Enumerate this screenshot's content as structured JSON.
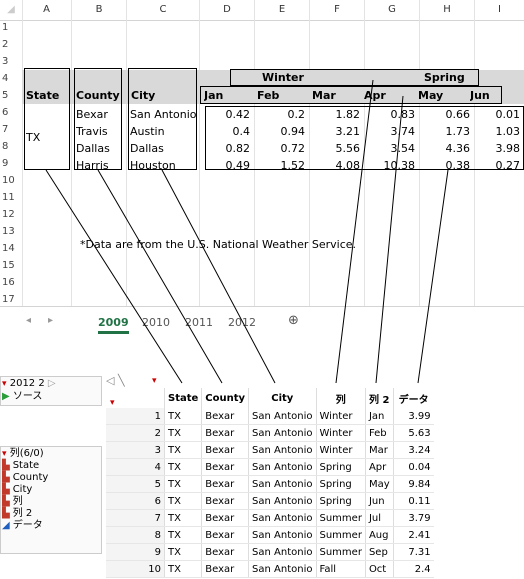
{
  "spreadsheet": {
    "columns": [
      "A",
      "B",
      "C",
      "D",
      "E",
      "F",
      "G",
      "H",
      "I"
    ],
    "rows": [
      "1",
      "2",
      "3",
      "4",
      "5",
      "6",
      "7",
      "8",
      "9",
      "10",
      "11",
      "12",
      "13",
      "14",
      "15",
      "16",
      "17"
    ],
    "header_row4": {
      "winter": "Winter",
      "spring": "Spring"
    },
    "header_row5": {
      "state": "State",
      "county": "County",
      "city": "City",
      "months": [
        "Jan",
        "Feb",
        "Mar",
        "Apr",
        "May",
        "Jun"
      ]
    },
    "state_value": "TX",
    "data_rows": [
      {
        "county": "Bexar",
        "city": "San Antonio",
        "values": [
          "0.42",
          "0.2",
          "1.82",
          "0.83",
          "0.66",
          "0.01"
        ]
      },
      {
        "county": "Travis",
        "city": "Austin",
        "values": [
          "0.4",
          "0.94",
          "3.21",
          "3.74",
          "1.73",
          "1.03"
        ]
      },
      {
        "county": "Dallas",
        "city": "Dallas",
        "values": [
          "0.82",
          "0.72",
          "5.56",
          "3.54",
          "4.36",
          "3.98"
        ]
      },
      {
        "county": "Harris",
        "city": "Houston",
        "values": [
          "0.49",
          "1.52",
          "4.08",
          "10.38",
          "0.38",
          "0.27"
        ]
      }
    ],
    "footnote": "*Data are from the U.S. National Weather Service.",
    "sheet_tabs": [
      "2009",
      "2010",
      "2011",
      "2012"
    ],
    "active_tab": "2009",
    "add_sheet_symbol": "⊕",
    "nav_prev": "◂",
    "nav_next": "▸"
  },
  "jmp": {
    "table_name": "2012 2",
    "source_label": "ソース",
    "columns_header": "列(6/0)",
    "column_list": [
      "State",
      "County",
      "City",
      "列",
      "列 2",
      "データ"
    ],
    "table_headers": [
      "State",
      "County",
      "City",
      "列",
      "列 2",
      "データ"
    ],
    "rows": [
      [
        "1",
        "TX",
        "Bexar",
        "San Antonio",
        "Winter",
        "Jan",
        "3.99"
      ],
      [
        "2",
        "TX",
        "Bexar",
        "San Antonio",
        "Winter",
        "Feb",
        "5.63"
      ],
      [
        "3",
        "TX",
        "Bexar",
        "San Antonio",
        "Winter",
        "Mar",
        "3.24"
      ],
      [
        "4",
        "TX",
        "Bexar",
        "San Antonio",
        "Spring",
        "Apr",
        "0.04"
      ],
      [
        "5",
        "TX",
        "Bexar",
        "San Antonio",
        "Spring",
        "May",
        "9.84"
      ],
      [
        "6",
        "TX",
        "Bexar",
        "San Antonio",
        "Spring",
        "Jun",
        "0.11"
      ],
      [
        "7",
        "TX",
        "Bexar",
        "San Antonio",
        "Summer",
        "Jul",
        "3.79"
      ],
      [
        "8",
        "TX",
        "Bexar",
        "San Antonio",
        "Summer",
        "Aug",
        "2.41"
      ],
      [
        "9",
        "TX",
        "Bexar",
        "San Antonio",
        "Summer",
        "Sep",
        "7.31"
      ],
      [
        "10",
        "TX",
        "Bexar",
        "San Antonio",
        "Fall",
        "Oct",
        "2.4"
      ]
    ]
  },
  "colors": {
    "band": "#d9d9d9",
    "active_tab": "#217346",
    "nominal_icon": "#c0392b",
    "continuous_icon": "#1f5fbf"
  }
}
